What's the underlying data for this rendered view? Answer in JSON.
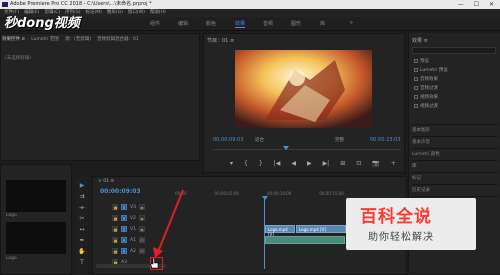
{
  "window": {
    "title": "Adobe Premiere Pro CC 2018 - C:\\Users\\...\\未命名.prproj *"
  },
  "brand": {
    "text": "秒dong视频"
  },
  "menu": [
    "文件(F)",
    "编辑(E)",
    "剪辑(C)",
    "序列(S)",
    "标记(M)",
    "图形(G)",
    "窗口(W)",
    "帮助(H)"
  ],
  "workspaces": {
    "tabs": [
      {
        "label": "组件"
      },
      {
        "label": "编辑"
      },
      {
        "label": "颜色"
      },
      {
        "label": "效果"
      },
      {
        "label": "音频"
      },
      {
        "label": "图形"
      },
      {
        "label": "库"
      }
    ]
  },
  "source": {
    "tabs": [
      "效果控件 ≡",
      "Lumetri 范围",
      "源：(无剪辑)",
      "音频剪辑混合器：01"
    ],
    "meta": "(未选择剪辑)"
  },
  "program": {
    "title": "节目：01 ≡",
    "timecode_left": "00:00:09:03",
    "timecode_right": "00:00:23:03",
    "fit": "适合",
    "full": "完整",
    "transport": [
      "▾",
      "{",
      "}",
      "|◀",
      "◀",
      "▶",
      "▶|",
      "⊞",
      "⊡",
      "📷",
      "+"
    ]
  },
  "effects": {
    "title": "效果 ≡",
    "items": [
      "预设",
      "Lumetri 预设",
      "音频效果",
      "音频过渡",
      "视频效果",
      "视频过渡"
    ],
    "sections": [
      "基本图形",
      "基本声音",
      "Lumetri 颜色",
      "库",
      "标记",
      "历史记录",
      "信息"
    ]
  },
  "project": {
    "items": [
      {
        "label": "Logo"
      },
      {
        "label": "Logo"
      }
    ]
  },
  "timeline": {
    "name": "× 01 ≡",
    "timecode": "00:00:09:03",
    "ticks": [
      "00:00",
      "00:00:05:00",
      "00:00:10:00",
      "00:00:15:00"
    ],
    "tracks": [
      {
        "name": "V3"
      },
      {
        "name": "V2"
      },
      {
        "name": "V1"
      },
      {
        "name": "A1"
      },
      {
        "name": "A2"
      },
      {
        "name": "A3"
      }
    ],
    "clip_labels": {
      "v1a": "Logo.mp4 [V]",
      "v1b": "Logo.mp4 [V]"
    }
  },
  "watermark": {
    "main": "百科全说",
    "sub": "助你轻松解决"
  },
  "colors": {
    "accent": "#4d8fd6",
    "highlight": "#e02020"
  }
}
